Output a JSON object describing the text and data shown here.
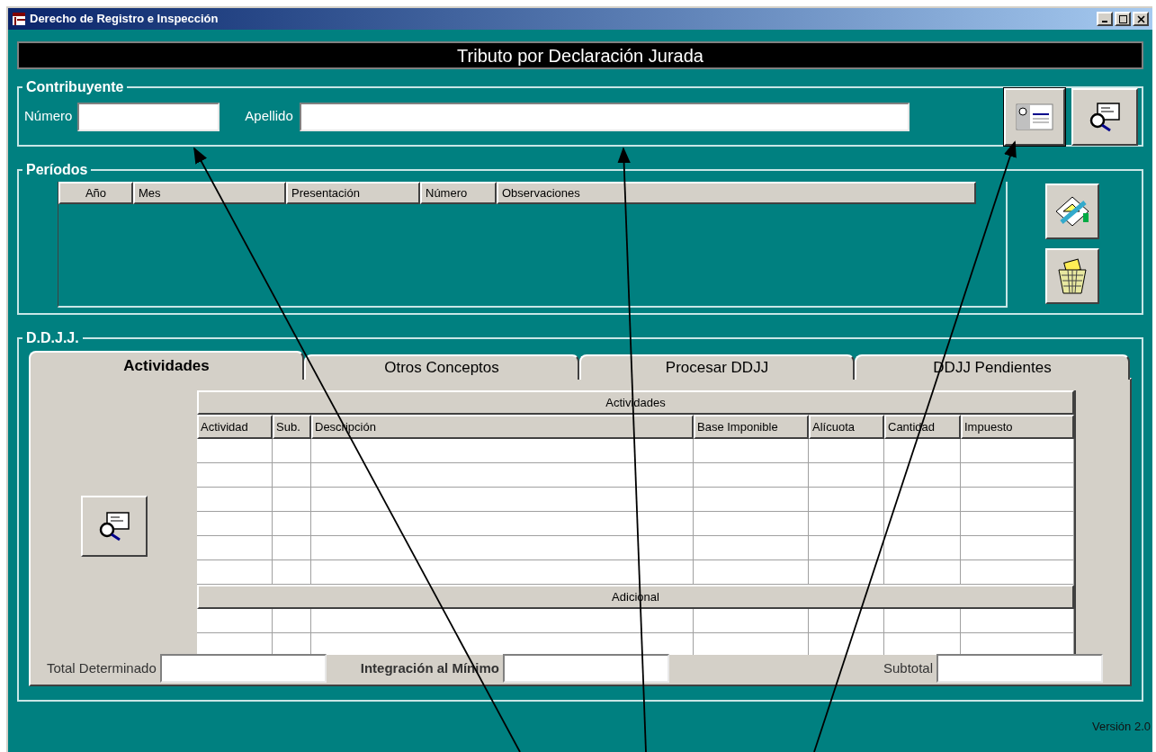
{
  "window": {
    "title": "Derecho de Registro e Inspección"
  },
  "header": "Tributo por Declaración Jurada",
  "contribuyente": {
    "legend": "Contribuyente",
    "fields": [
      {
        "label": "Número"
      },
      {
        "label": "Apellido"
      }
    ]
  },
  "periodos": {
    "legend": "Períodos",
    "columns": [
      "Año",
      "Mes",
      "Presentación",
      "Número",
      "Observaciones"
    ]
  },
  "ddjj": {
    "legend": "D.D.J.J.",
    "tabs": [
      {
        "label": "Actividades",
        "selected": true
      },
      {
        "label": "Otros Conceptos",
        "selected": false
      },
      {
        "label": "Procesar DDJJ",
        "selected": false
      },
      {
        "label": "DDJJ Pendientes",
        "selected": false
      }
    ],
    "table": {
      "group_header": "Actividades",
      "columns": [
        "Actividad",
        "Sub.",
        "Descripción",
        "Base Imponible",
        "Alícuota",
        "Cantidad",
        "Impuesto"
      ],
      "section_header": "Adicional"
    },
    "totals": [
      {
        "label": "Total Determinado",
        "bold": false
      },
      {
        "label": "Integración al Mínimo",
        "bold": true
      },
      {
        "label": "Subtotal",
        "bold": false
      }
    ]
  },
  "version": "Versión 2.0"
}
